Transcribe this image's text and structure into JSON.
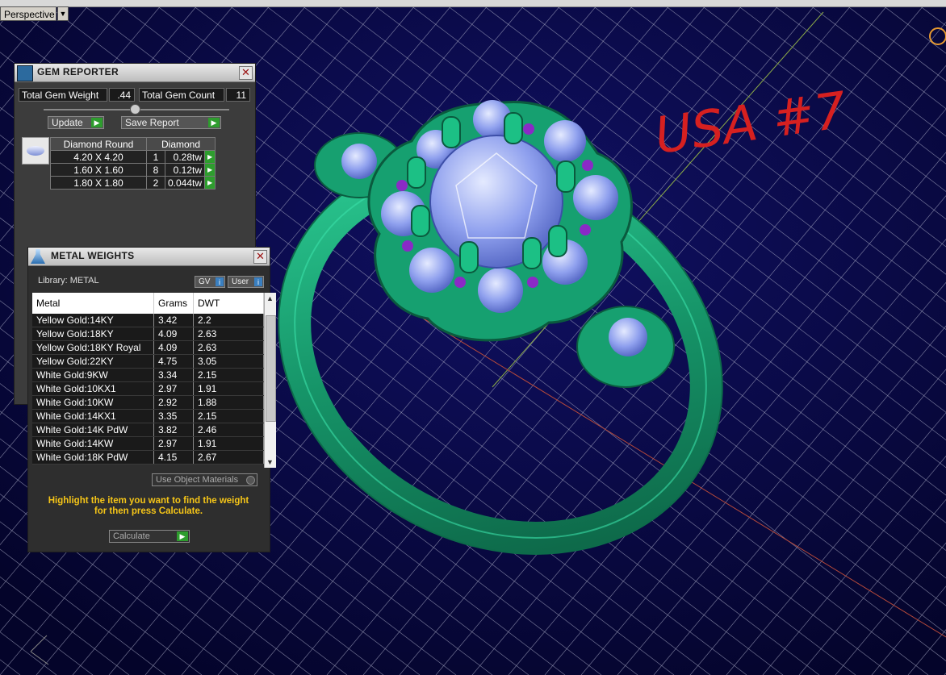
{
  "viewport": {
    "label": "Perspective",
    "annotation": "USA #7"
  },
  "gem_reporter": {
    "title": "GEM REPORTER",
    "total_weight_label": "Total Gem Weight",
    "total_weight_value": ".44",
    "total_count_label": "Total Gem Count",
    "total_count_value": "11",
    "update_label": "Update",
    "save_report_label": "Save Report",
    "table_headers": [
      "Diamond Round",
      "Diamond"
    ],
    "rows": [
      {
        "size": "4.20 X 4.20",
        "count": "1",
        "weight": "0.28tw"
      },
      {
        "size": "1.60 X 1.60",
        "count": "8",
        "weight": "0.12tw"
      },
      {
        "size": "1.80 X 1.80",
        "count": "2",
        "weight": "0.044tw"
      }
    ]
  },
  "metal_weights": {
    "title": "METAL WEIGHTS",
    "library_label": "Library: METAL",
    "gv_label": "GV",
    "user_label": "User",
    "columns": [
      "Metal",
      "Grams",
      "DWT"
    ],
    "rows": [
      {
        "metal": "Yellow Gold:14KY",
        "grams": "3.42",
        "dwt": "2.2"
      },
      {
        "metal": "Yellow Gold:18KY",
        "grams": "4.09",
        "dwt": "2.63"
      },
      {
        "metal": "Yellow Gold:18KY Royal",
        "grams": "4.09",
        "dwt": "2.63"
      },
      {
        "metal": "Yellow Gold:22KY",
        "grams": "4.75",
        "dwt": "3.05"
      },
      {
        "metal": "White Gold:9KW",
        "grams": "3.34",
        "dwt": "2.15"
      },
      {
        "metal": "White Gold:10KX1",
        "grams": "2.97",
        "dwt": "1.91"
      },
      {
        "metal": "White Gold:10KW",
        "grams": "2.92",
        "dwt": "1.88"
      },
      {
        "metal": "White Gold:14KX1",
        "grams": "3.35",
        "dwt": "2.15"
      },
      {
        "metal": "White Gold:14K PdW",
        "grams": "3.82",
        "dwt": "2.46"
      },
      {
        "metal": "White Gold:14KW",
        "grams": "2.97",
        "dwt": "1.91"
      },
      {
        "metal": "White Gold:18K PdW",
        "grams": "4.15",
        "dwt": "2.67"
      }
    ],
    "use_object_materials_label": "Use Object Materials",
    "instruction": "Highlight the item you want to find the weight for then press Calculate.",
    "calculate_label": "Calculate"
  },
  "colors": {
    "background": "#0a0a45",
    "grid": "#a8aac4",
    "ring": "#1f9c6e",
    "gem": "#9aaaf0",
    "accent_gem": "#8a2ac6",
    "annotation": "#d62020"
  }
}
